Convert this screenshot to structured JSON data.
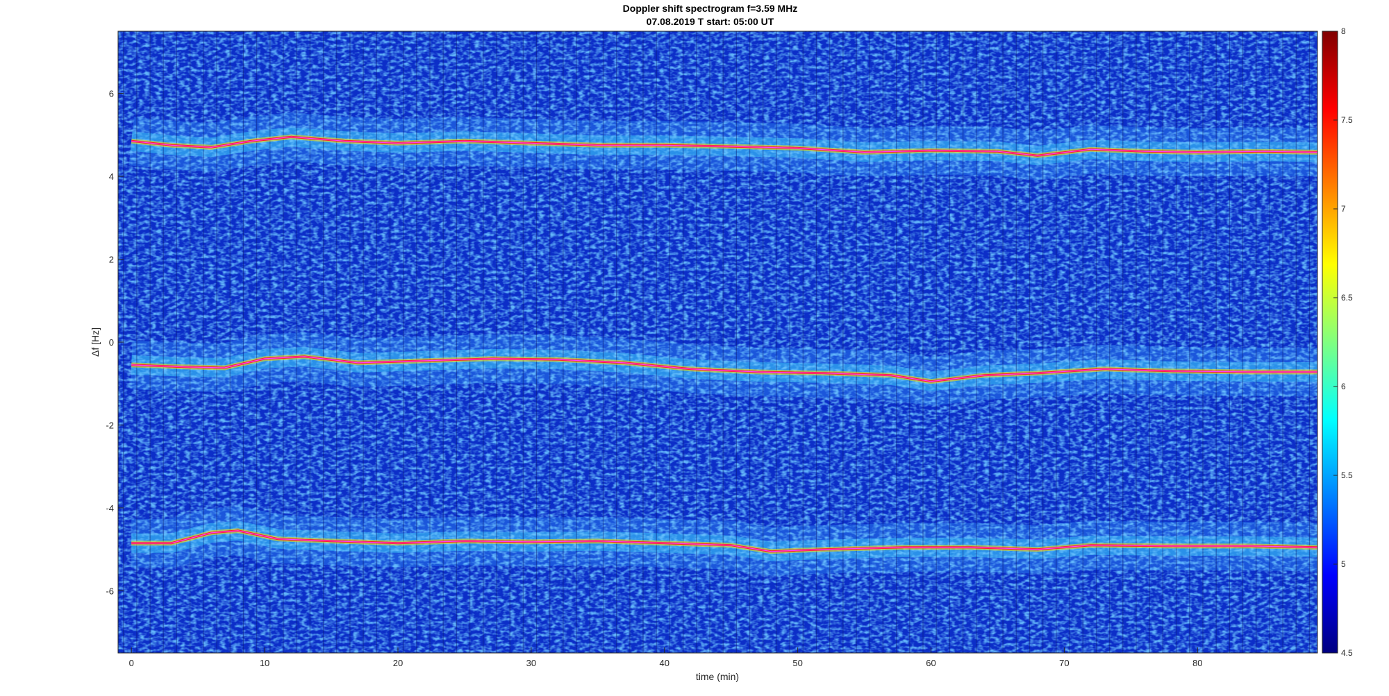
{
  "chart_data": {
    "type": "heatmap",
    "title": "Doppler shift spectrogram f=3.59 MHz",
    "subtitle": "07.08.2019   T start: 05:00 UT",
    "xlabel": "time (min)",
    "ylabel": "Δf [Hz]",
    "xlim": [
      -1,
      89
    ],
    "ylim": [
      -7.5,
      7.5
    ],
    "xticks": [
      0,
      10,
      20,
      30,
      40,
      50,
      60,
      70,
      80
    ],
    "yticks": [
      -6,
      -4,
      -2,
      0,
      2,
      4,
      6
    ],
    "colorbar": {
      "range": [
        4.5,
        8
      ],
      "ticks": [
        "4.5",
        "5",
        "5.5",
        "6",
        "6.5",
        "7",
        "7.5",
        "8"
      ],
      "colormap": "jet"
    },
    "grid": false,
    "series": [
      {
        "values": [
          {
            "t": 0,
            "df": 4.85
          },
          {
            "t": 3,
            "df": 4.75
          },
          {
            "t": 6,
            "df": 4.7
          },
          {
            "t": 9,
            "df": 4.85
          },
          {
            "t": 12,
            "df": 4.95
          },
          {
            "t": 16,
            "df": 4.85
          },
          {
            "t": 20,
            "df": 4.8
          },
          {
            "t": 25,
            "df": 4.85
          },
          {
            "t": 30,
            "df": 4.8
          },
          {
            "t": 35,
            "df": 4.75
          },
          {
            "t": 40,
            "df": 4.75
          },
          {
            "t": 45,
            "df": 4.72
          },
          {
            "t": 50,
            "df": 4.68
          },
          {
            "t": 55,
            "df": 4.58
          },
          {
            "t": 60,
            "df": 4.62
          },
          {
            "t": 65,
            "df": 4.6
          },
          {
            "t": 68,
            "df": 4.5
          },
          {
            "t": 72,
            "df": 4.65
          },
          {
            "t": 76,
            "df": 4.6
          },
          {
            "t": 80,
            "df": 4.58
          },
          {
            "t": 85,
            "df": 4.6
          },
          {
            "t": 89,
            "df": 4.58
          }
        ]
      },
      {
        "values": [
          {
            "t": 0,
            "df": -0.55
          },
          {
            "t": 4,
            "df": -0.6
          },
          {
            "t": 7,
            "df": -0.62
          },
          {
            "t": 10,
            "df": -0.4
          },
          {
            "t": 13,
            "df": -0.35
          },
          {
            "t": 17,
            "df": -0.5
          },
          {
            "t": 22,
            "df": -0.45
          },
          {
            "t": 27,
            "df": -0.4
          },
          {
            "t": 32,
            "df": -0.42
          },
          {
            "t": 37,
            "df": -0.5
          },
          {
            "t": 42,
            "df": -0.65
          },
          {
            "t": 47,
            "df": -0.72
          },
          {
            "t": 52,
            "df": -0.75
          },
          {
            "t": 57,
            "df": -0.8
          },
          {
            "t": 60,
            "df": -0.95
          },
          {
            "t": 64,
            "df": -0.8
          },
          {
            "t": 68,
            "df": -0.75
          },
          {
            "t": 73,
            "df": -0.65
          },
          {
            "t": 78,
            "df": -0.7
          },
          {
            "t": 84,
            "df": -0.72
          },
          {
            "t": 89,
            "df": -0.72
          }
        ]
      },
      {
        "values": [
          {
            "t": 0,
            "df": -4.85
          },
          {
            "t": 3,
            "df": -4.85
          },
          {
            "t": 6,
            "df": -4.6
          },
          {
            "t": 8,
            "df": -4.55
          },
          {
            "t": 11,
            "df": -4.75
          },
          {
            "t": 15,
            "df": -4.8
          },
          {
            "t": 20,
            "df": -4.85
          },
          {
            "t": 25,
            "df": -4.8
          },
          {
            "t": 30,
            "df": -4.82
          },
          {
            "t": 35,
            "df": -4.8
          },
          {
            "t": 40,
            "df": -4.85
          },
          {
            "t": 45,
            "df": -4.9
          },
          {
            "t": 48,
            "df": -5.05
          },
          {
            "t": 52,
            "df": -5.0
          },
          {
            "t": 58,
            "df": -4.95
          },
          {
            "t": 63,
            "df": -4.95
          },
          {
            "t": 68,
            "df": -5.0
          },
          {
            "t": 72,
            "df": -4.9
          },
          {
            "t": 78,
            "df": -4.92
          },
          {
            "t": 84,
            "df": -4.92
          },
          {
            "t": 89,
            "df": -4.95
          }
        ]
      }
    ]
  }
}
